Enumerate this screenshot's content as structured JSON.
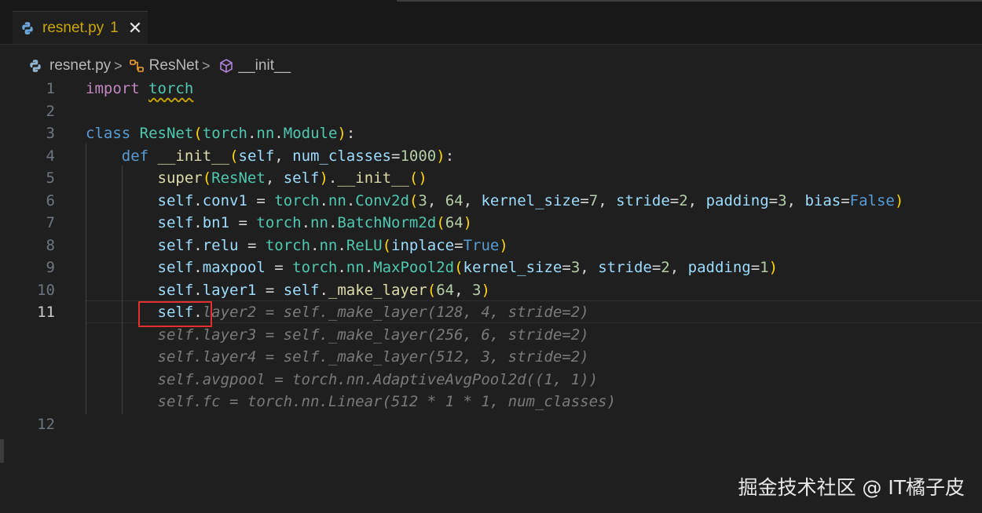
{
  "tab": {
    "filename": "resnet.py",
    "problems": "1",
    "close": "✕",
    "icon": "python-icon"
  },
  "breadcrumb": {
    "file": "resnet.py",
    "separator": ">",
    "class_name": "ResNet",
    "method": "__init__"
  },
  "editor": {
    "active_line": "11",
    "line_numbers": [
      "1",
      "2",
      "3",
      "4",
      "5",
      "6",
      "7",
      "8",
      "9",
      "10",
      "11",
      "12"
    ],
    "lines": [
      "import torch",
      "",
      "class ResNet(torch.nn.Module):",
      "    def __init__(self, num_classes=1000):",
      "        super(ResNet, self).__init__()",
      "        self.conv1 = torch.nn.Conv2d(3, 64, kernel_size=7, stride=2, padding=3, bias=False)",
      "        self.bn1 = torch.nn.BatchNorm2d(64)",
      "        self.relu = torch.nn.ReLU(inplace=True)",
      "        self.maxpool = torch.nn.MaxPool2d(kernel_size=3, stride=2, padding=1)",
      "        self.layer1 = self._make_layer(64, 3)",
      "        self.",
      ""
    ],
    "ghost_text": [
      "layer2 = self._make_layer(128, 4, stride=2)",
      "self.layer3 = self._make_layer(256, 6, stride=2)",
      "self.layer4 = self._make_layer(512, 3, stride=2)",
      "self.avgpool = torch.nn.AdaptiveAvgPool2d((1, 1))",
      "self.fc = torch.nn.Linear(512 * 1 * 1, num_classes)"
    ]
  },
  "watermark": "掘金技术社区 @ IT橘子皮",
  "colors": {
    "background": "#1f1f1f",
    "keyword": "#c586c0",
    "class": "#4ec9b0",
    "variable": "#9cdcfe",
    "number": "#b5cea8",
    "ghost": "#7a7a7a",
    "highlight_box": "#e2302c"
  }
}
